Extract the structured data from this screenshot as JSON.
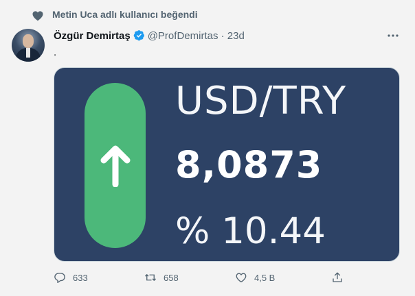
{
  "social_context": {
    "text": "Metin Uca adlı kullanıcı beğendi",
    "icon": "heart-icon"
  },
  "author": {
    "name": "Özgür Demirtaş",
    "handle": "@ProfDemirtas",
    "separator": "·",
    "time": "23d",
    "verified": true
  },
  "tweet": {
    "text": "."
  },
  "card": {
    "pair": "USD/TRY",
    "rate": "8,0873",
    "change": "% 10.44",
    "direction": "up",
    "colors": {
      "background": "#2d4265",
      "pill": "#4cb87a",
      "text": "#ffffff"
    }
  },
  "actions": {
    "reply_count": "633",
    "retweet_count": "658",
    "like_count": "4,5 B"
  },
  "colors": {
    "secondary_text": "#536471",
    "verified_blue": "#1d9bf0"
  }
}
